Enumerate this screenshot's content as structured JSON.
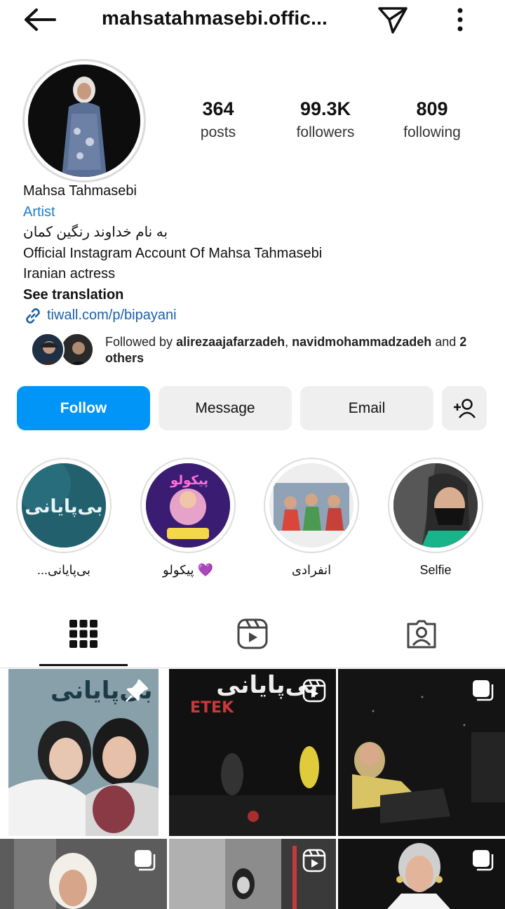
{
  "header": {
    "username": "mahsatahmasebi.offic...",
    "back_icon": "arrow-left-icon",
    "send_icon": "paper-plane-icon",
    "more_icon": "vertical-dots-icon"
  },
  "stats": {
    "posts": {
      "value": "364",
      "label": "posts"
    },
    "followers": {
      "value": "99.3K",
      "label": "followers"
    },
    "following": {
      "value": "809",
      "label": "following"
    }
  },
  "bio": {
    "name": "Mahsa Tahmasebi",
    "category": "Artist",
    "line1": "به نام خداوند رنگین کمان",
    "line2": "Official Instagram Account Of Mahsa Tahmasebi",
    "line3": "Iranian actress",
    "see_translation": "See translation",
    "link": "tiwall.com/p/bipayani"
  },
  "followed_by": {
    "prefix": "Followed by ",
    "user1": "alirezaajafarzadeh",
    "sep": ", ",
    "user2": "navidmohammadzadeh",
    "mid": " and ",
    "others": "2 others"
  },
  "buttons": {
    "follow": "Follow",
    "message": "Message",
    "email": "Email",
    "add_user_icon": "add-person-icon"
  },
  "highlights": [
    {
      "label": "بی‌پایانی...",
      "cover_text": "بی‌پایانی"
    },
    {
      "label": "💜 پیکولو",
      "cover_text": "پیکولو"
    },
    {
      "label": "انفرادی"
    },
    {
      "label": "Selfie"
    }
  ],
  "tabs": {
    "grid_icon": "grid-icon",
    "reels_icon": "reels-icon",
    "tagged_icon": "tagged-person-icon"
  },
  "grid": [
    {
      "badge": "pin-icon",
      "overlay": "بی‌پایانی"
    },
    {
      "badge": "reel-icon",
      "overlay": "بی‌پایانی",
      "sub": "ETEK"
    },
    {
      "badge": "carousel-icon"
    },
    {
      "badge": "carousel-icon"
    },
    {
      "badge": "reel-icon"
    },
    {
      "badge": "carousel-icon"
    }
  ],
  "colors": {
    "accent": "#0095f6",
    "category": "#1a7ccf",
    "link": "#1a5fa8"
  }
}
